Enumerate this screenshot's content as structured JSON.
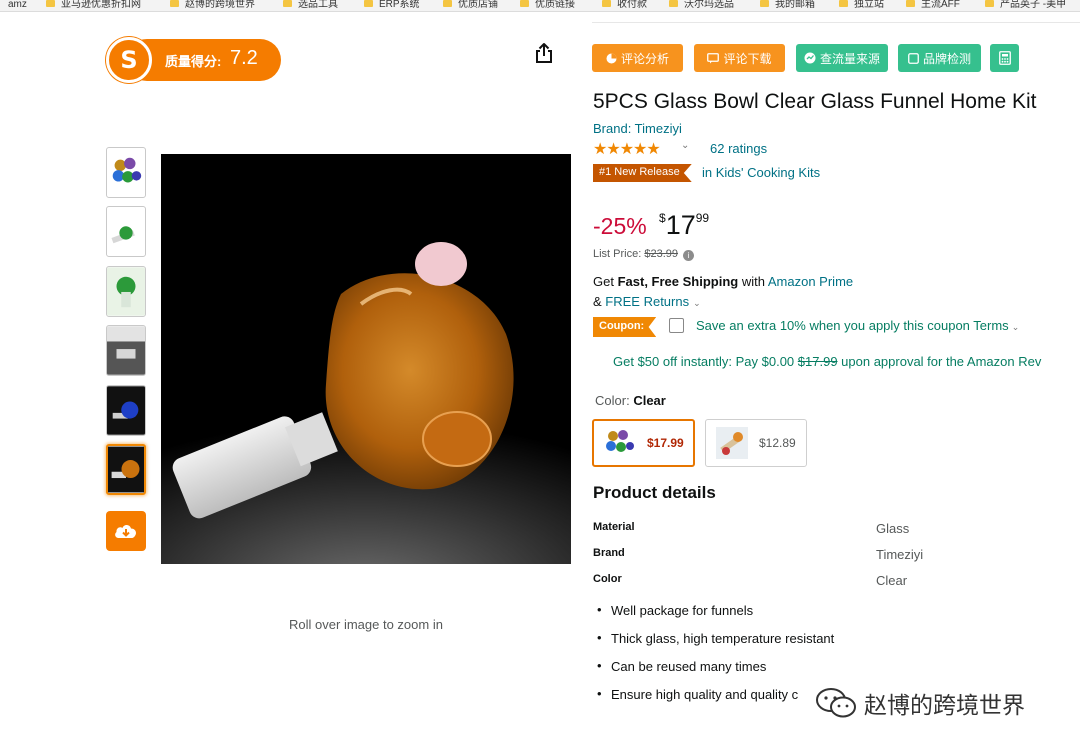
{
  "bookmarks": [
    {
      "label": "amz",
      "folder": false
    },
    {
      "label": "亚马逊优惠折扣网",
      "folder": true
    },
    {
      "label": "赵博的跨境世界",
      "folder": true
    },
    {
      "label": "选品工具",
      "folder": true
    },
    {
      "label": "ERP系统",
      "folder": true
    },
    {
      "label": "优质店铺",
      "folder": true
    },
    {
      "label": "优质链接",
      "folder": true
    },
    {
      "label": "收付款",
      "folder": true
    },
    {
      "label": "沃尔玛选品",
      "folder": true
    },
    {
      "label": "我的邮箱",
      "folder": true
    },
    {
      "label": "独立站",
      "folder": true
    },
    {
      "label": "主流AFF",
      "folder": true
    },
    {
      "label": "产品英子 -美甲",
      "folder": true
    }
  ],
  "quality": {
    "label": "质量得分:",
    "score": "7.2"
  },
  "tools": [
    {
      "label": "评论分析",
      "icon": "pie-icon",
      "color": "#f7931e"
    },
    {
      "label": "评论下载",
      "icon": "comment-icon",
      "color": "#f7931e"
    },
    {
      "label": "查流量来源",
      "icon": "traffic-icon",
      "color": "#36c08e"
    },
    {
      "label": "品牌检测",
      "icon": "checkbox-icon",
      "color": "#36c08e"
    },
    {
      "label": "",
      "icon": "calculator-icon",
      "color": "#36c08e"
    }
  ],
  "product": {
    "title": "5PCS Glass Bowl Clear Glass Funnel Home Kit",
    "brand_link": "Brand: Timeziyi",
    "stars": "★★★★★",
    "rating_value": 5,
    "ratings": "62 ratings",
    "release_badge": "#1 New Release",
    "release_category": "in Kids' Cooking Kits",
    "discount": "-25%",
    "price_symbol": "$",
    "price_whole": "17",
    "price_fraction": "99",
    "list_price_label": "List Price:",
    "list_price": "$23.99",
    "shipping_get": "Get",
    "shipping_fast": "Fast, Free Shipping",
    "shipping_with": "with",
    "shipping_prime": "Amazon Prime",
    "returns_amp": "&",
    "returns_link": "FREE Returns",
    "coupon_label": "Coupon:",
    "coupon_text": "Save an extra 10% when you apply this coupon",
    "coupon_terms": "Terms",
    "credit_offer_pre": "Get $50 off instantly: Pay $0.00",
    "credit_offer_strike": "$17.99",
    "credit_offer_post": "upon approval for the Amazon Rev",
    "color_label": "Color:",
    "color_value": "Clear",
    "swatches": [
      {
        "price": "$17.99",
        "selected": true
      },
      {
        "price": "$12.89",
        "selected": false
      }
    ],
    "zoom_hint": "Roll over image to zoom in"
  },
  "details": {
    "title": "Product details",
    "rows": [
      {
        "key": "Material",
        "value": "Glass"
      },
      {
        "key": "Brand",
        "value": "Timeziyi"
      },
      {
        "key": "Color",
        "value": "Clear"
      }
    ],
    "bullets": [
      "Well package for funnels",
      "Thick glass, high temperature resistant",
      "Can be reused many times",
      "Ensure high quality and quality c"
    ]
  },
  "watermark": {
    "text": "赵博的跨境世界"
  },
  "colors": {
    "orange": "#f57c00",
    "green": "#36c08e",
    "link": "#007185",
    "deal_red": "#cc0c39",
    "coupon_green": "#067d62"
  }
}
